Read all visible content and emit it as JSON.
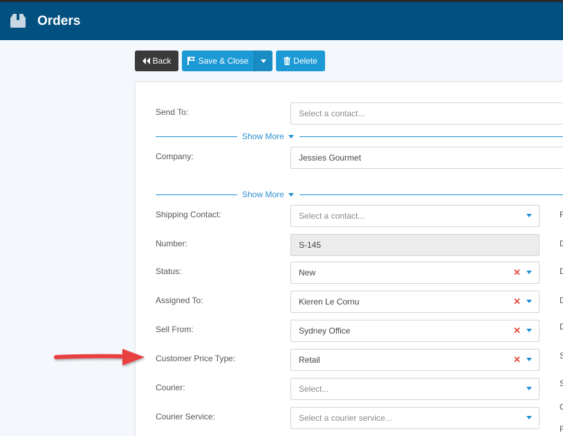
{
  "header": {
    "title": "Orders",
    "icon": "box-icon"
  },
  "toolbar": {
    "back_label": "Back",
    "save_close_label": "Save & Close",
    "delete_label": "Delete"
  },
  "form": {
    "send_to": {
      "label": "Send To:",
      "placeholder": "Select a contact..."
    },
    "show_more_1": "Show More",
    "company": {
      "label": "Company:",
      "value": "Jessies Gourmet"
    },
    "show_more_2": "Show More",
    "shipping_contact": {
      "label": "Shipping Contact:",
      "placeholder": "Select a contact..."
    },
    "number": {
      "label": "Number:",
      "value": "S-145"
    },
    "status": {
      "label": "Status:",
      "value": "New"
    },
    "assigned_to": {
      "label": "Assigned To:",
      "value": "Kieren Le Cornu"
    },
    "sell_from": {
      "label": "Sell From:",
      "value": "Sydney Office"
    },
    "customer_price_type": {
      "label": "Customer Price Type:",
      "value": "Retail"
    },
    "courier": {
      "label": "Courier:",
      "placeholder": "Select..."
    },
    "courier_service": {
      "label": "Courier Service:",
      "placeholder": "Select a courier service..."
    }
  },
  "side_column": [
    "F",
    "D",
    "D",
    "D",
    "D",
    "S",
    "S",
    "C",
    "F"
  ],
  "colors": {
    "header": "#02507f",
    "accent": "#1c9ad6",
    "back": "#3a3a3a",
    "clear": "#e64b3b",
    "arrow": "#e8413f"
  }
}
